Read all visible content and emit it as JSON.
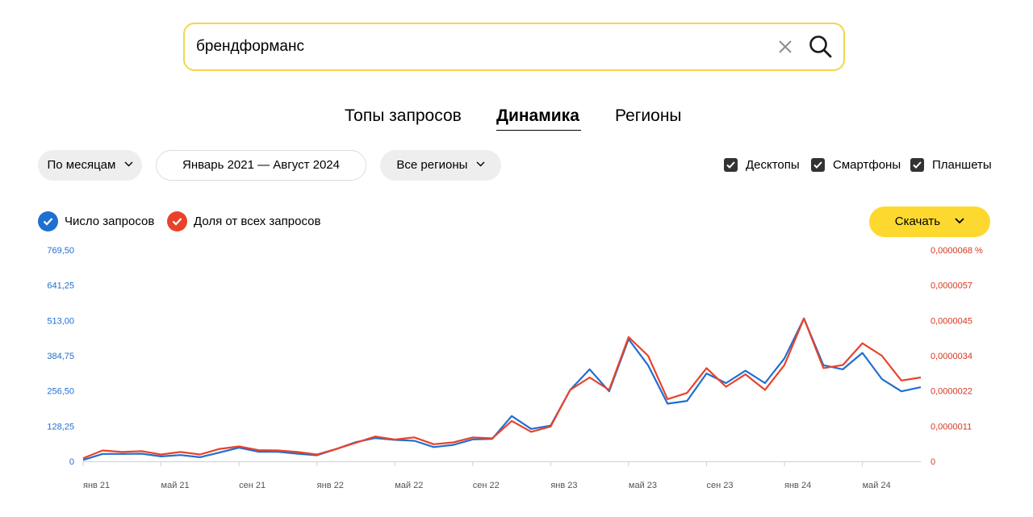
{
  "search": {
    "value": "брендформанс"
  },
  "tabs": [
    {
      "label": "Топы запросов"
    },
    {
      "label": "Динамика"
    },
    {
      "label": "Регионы"
    }
  ],
  "filters": {
    "period": "По месяцам",
    "date_range": "Январь 2021 — Август 2024",
    "region": "Все регионы"
  },
  "devices": [
    {
      "label": "Десктопы",
      "checked": true
    },
    {
      "label": "Смартфоны",
      "checked": true
    },
    {
      "label": "Планшеты",
      "checked": true
    }
  ],
  "legend": [
    {
      "label": "Число запросов",
      "color": "#1f6fd1"
    },
    {
      "label": "Доля от всех запросов",
      "color": "#e8432a"
    }
  ],
  "download_label": "Скачать",
  "chart_data": {
    "type": "line",
    "x": [
      "янв 21",
      "фев 21",
      "мар 21",
      "апр 21",
      "май 21",
      "июн 21",
      "июл 21",
      "авг 21",
      "сен 21",
      "окт 21",
      "ноя 21",
      "дек 21",
      "янв 22",
      "фев 22",
      "мар 22",
      "апр 22",
      "май 22",
      "июн 22",
      "июл 22",
      "авг 22",
      "сен 22",
      "окт 22",
      "ноя 22",
      "дек 22",
      "янв 23",
      "фев 23",
      "мар 23",
      "апр 23",
      "май 23",
      "июн 23",
      "июл 23",
      "авг 23",
      "сен 23",
      "окт 23",
      "ноя 23",
      "дек 23",
      "янв 24",
      "фев 24",
      "мар 24",
      "апр 24",
      "май 24",
      "июн 24",
      "июл 24",
      "авг 24"
    ],
    "x_ticks": [
      "янв 21",
      "май 21",
      "сен 21",
      "янв 22",
      "май 22",
      "сен 22",
      "янв 23",
      "май 23",
      "сен 23",
      "янв 24",
      "май 24"
    ],
    "y_left": {
      "ticks": [
        "0",
        "128,25",
        "256,50",
        "384,75",
        "513,00",
        "641,25",
        "769,50"
      ],
      "min": 0,
      "max": 769.5
    },
    "y_right": {
      "ticks": [
        "0",
        "0,0000011",
        "0,0000022",
        "0,0000034",
        "0,0000045",
        "0,0000057",
        "0,0000068 %"
      ],
      "min": 0,
      "max": 6.8e-06
    },
    "series": [
      {
        "name": "Число запросов",
        "axis": "left",
        "color": "#1f6fd1",
        "values": [
          5,
          27,
          27,
          28,
          18,
          23,
          15,
          32,
          50,
          35,
          35,
          28,
          22,
          45,
          70,
          85,
          78,
          75,
          52,
          60,
          80,
          82,
          165,
          118,
          130,
          260,
          335,
          255,
          445,
          350,
          210,
          220,
          320,
          285,
          330,
          285,
          375,
          520,
          350,
          335,
          395,
          300,
          255,
          270
        ]
      },
      {
        "name": "Доля от всех запросов",
        "axis": "right",
        "color": "#e8432a",
        "values": [
          1e-07,
          3.5e-07,
          3e-07,
          3.3e-07,
          2.2e-07,
          3e-07,
          2.2e-07,
          4e-07,
          4.8e-07,
          3.6e-07,
          3.5e-07,
          3e-07,
          2.2e-07,
          4e-07,
          6e-07,
          8e-07,
          7e-07,
          7.7e-07,
          5.5e-07,
          6.1e-07,
          7.7e-07,
          7.4e-07,
          1.3e-06,
          9.5e-07,
          1.12e-06,
          2.3e-06,
          2.7e-06,
          2.3e-06,
          4e-06,
          3.4e-06,
          2e-06,
          2.2e-06,
          3e-06,
          2.4e-06,
          2.8e-06,
          2.3e-06,
          3.1e-06,
          4.6e-06,
          3e-06,
          3.1e-06,
          3.8e-06,
          3.4e-06,
          2.6e-06,
          2.7e-06
        ]
      }
    ]
  }
}
